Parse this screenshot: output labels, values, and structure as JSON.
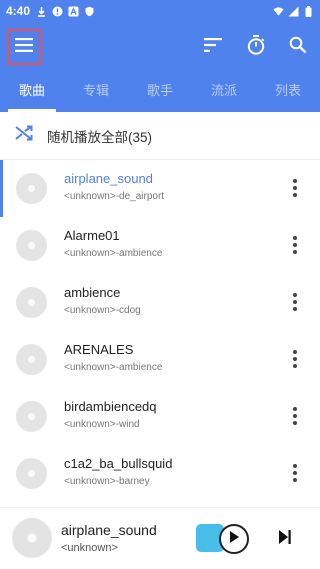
{
  "status_bar": {
    "time": "4:40"
  },
  "tabs": [
    {
      "label": "歌曲",
      "active": true
    },
    {
      "label": "专辑",
      "active": false
    },
    {
      "label": "歌手",
      "active": false
    },
    {
      "label": "流派",
      "active": false
    },
    {
      "label": "列表",
      "active": false
    }
  ],
  "shuffle": {
    "label": "随机播放全部(35)"
  },
  "songs": [
    {
      "title": "airplane_sound",
      "subtitle": "<unknown>-de_airport",
      "active": true
    },
    {
      "title": "Alarme01",
      "subtitle": "<unknown>-ambience",
      "active": false
    },
    {
      "title": "ambience",
      "subtitle": "<unknown>-cdog",
      "active": false
    },
    {
      "title": "ARENALES",
      "subtitle": "<unknown>-ambience",
      "active": false
    },
    {
      "title": "birdambiencedq",
      "subtitle": "<unknown>-wind",
      "active": false
    },
    {
      "title": "c1a2_ba_bullsquid",
      "subtitle": "<unknown>-barney",
      "active": false
    }
  ],
  "now_playing": {
    "title": "airplane_sound",
    "artist": "<unknown>"
  },
  "colors": {
    "primary": "#4f82ec",
    "highlight_border": "#e8505b"
  },
  "icons": [
    "menu-icon",
    "sort-icon",
    "timer-icon",
    "search-icon",
    "shuffle-icon",
    "more-vert-icon",
    "play-icon",
    "skip-next-icon"
  ]
}
